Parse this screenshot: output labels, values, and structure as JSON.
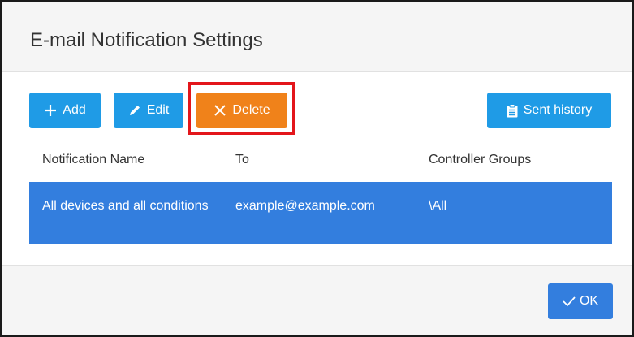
{
  "dialog": {
    "title": "E-mail Notification Settings"
  },
  "toolbar": {
    "add_label": "Add",
    "edit_label": "Edit",
    "delete_label": "Delete",
    "history_label": "Sent history"
  },
  "table": {
    "headers": [
      "Notification Name",
      "To",
      "Controller Groups"
    ],
    "rows": [
      {
        "name": "All devices and all conditions",
        "to": "example@example.com",
        "groups": "\\All"
      }
    ]
  },
  "footer": {
    "ok_label": "OK"
  },
  "colors": {
    "primary": "#1f9be6",
    "selected_row": "#337ede",
    "delete": "#f0821a",
    "highlight": "#e3161b"
  },
  "icons": {
    "add": "plus-icon",
    "edit": "pencil-icon",
    "delete": "x-icon",
    "history": "clipboard-icon",
    "ok": "checkmark-icon"
  }
}
